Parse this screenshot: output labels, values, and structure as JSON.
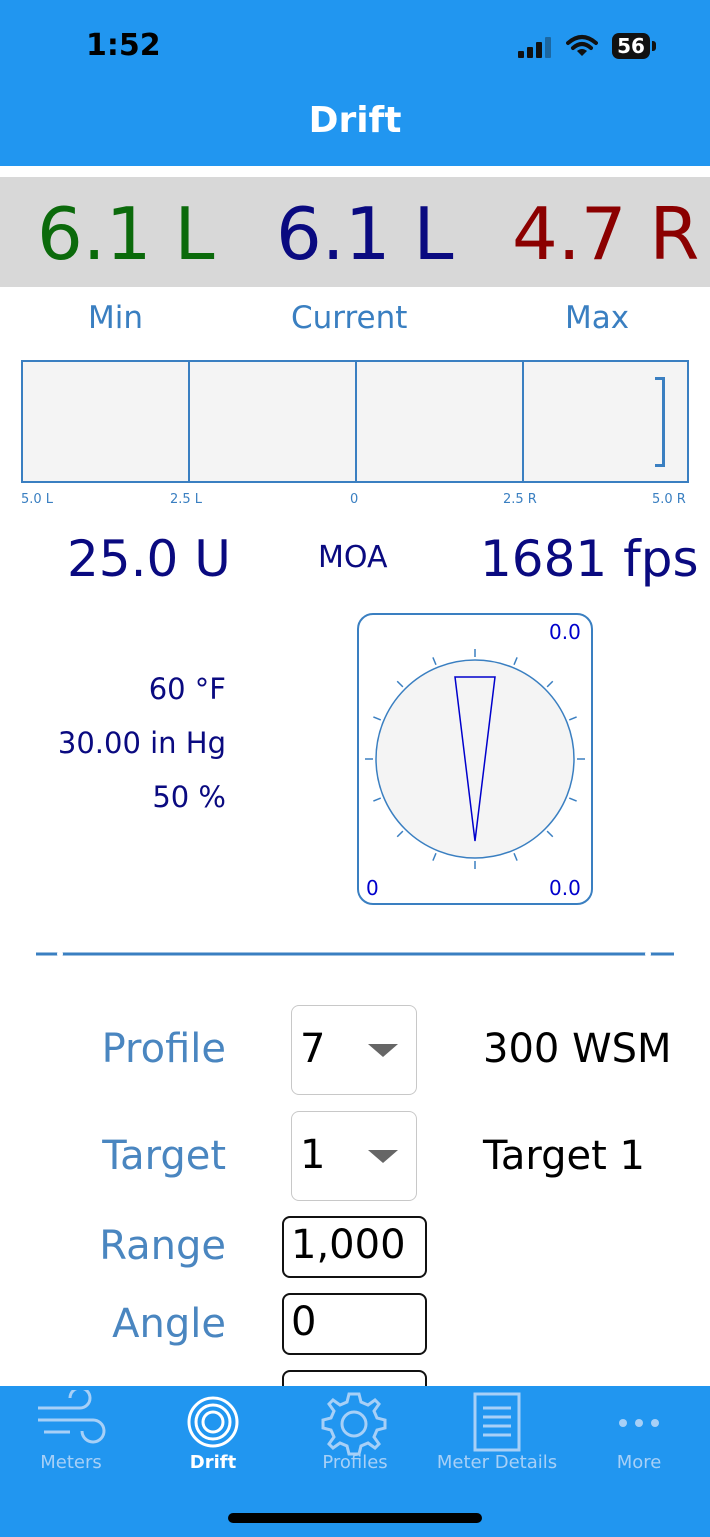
{
  "status_bar": {
    "time": "1:52",
    "battery": "56"
  },
  "header": {
    "title": "Drift"
  },
  "readouts": {
    "min": {
      "value": "6.1 L",
      "label": "Min",
      "color": "#0b6a0b"
    },
    "current": {
      "value": "6.1 L",
      "label": "Current",
      "color": "#0a0a80"
    },
    "max": {
      "value": "4.7 R",
      "label": "Max",
      "color": "#8b0000"
    }
  },
  "scale": {
    "ticks": [
      "5.0 L",
      "2.5 L",
      "0",
      "2.5 R",
      "5.0 R"
    ],
    "bracket_position": 0.97
  },
  "elevation": "25.0 U",
  "units": "MOA",
  "velocity": "1681 fps",
  "atmosphere": {
    "temperature": "60 °F",
    "pressure": "30.00 in Hg",
    "humidity": "50 %"
  },
  "compass": {
    "top_right": "0.0",
    "bottom_left": "0",
    "bottom_right": "0.0"
  },
  "form": {
    "profile": {
      "label": "Profile",
      "value": "7",
      "name": "300 WSM"
    },
    "target": {
      "label": "Target",
      "value": "1",
      "name": "Target 1"
    },
    "range": {
      "label": "Range",
      "value": "1,000"
    },
    "angle": {
      "label": "Angle",
      "value": "0"
    }
  },
  "tabs": [
    {
      "label": "Meters",
      "icon": "wind-icon",
      "active": false
    },
    {
      "label": "Drift",
      "icon": "target-icon",
      "active": true
    },
    {
      "label": "Profiles",
      "icon": "gear-icon",
      "active": false
    },
    {
      "label": "Meter Details",
      "icon": "document-icon",
      "active": false
    },
    {
      "label": "More",
      "icon": "more-icon",
      "active": false
    }
  ],
  "colors": {
    "accent": "#2196F0",
    "label_blue": "#3a7fc1",
    "navy": "#0a0a80"
  }
}
